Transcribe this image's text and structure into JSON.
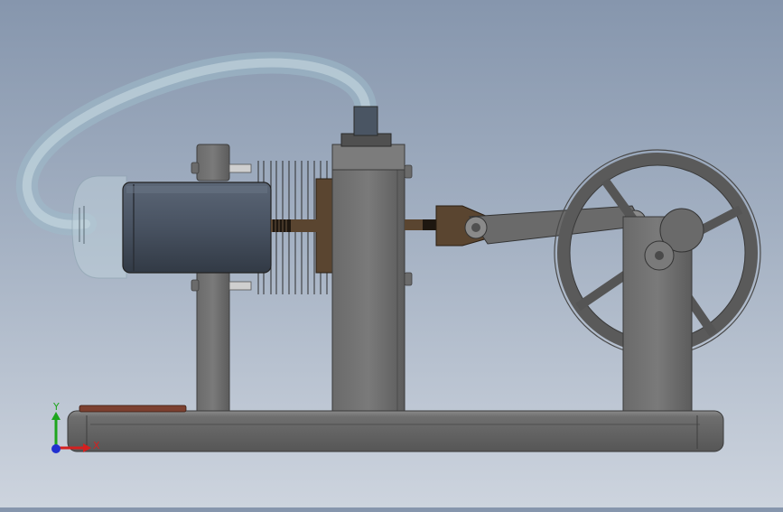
{
  "scene": {
    "kind": "cad-assembly-view",
    "subject": "stirling-engine-model",
    "background_top": "#8696ad",
    "background_bottom": "#cdd4de"
  },
  "colors": {
    "steel_dark": "#5e5e5e",
    "steel_mid": "#767676",
    "cylinder_body": "#4a5564",
    "brass_brown": "#5a4530",
    "hose_tint": "#b7d2de",
    "base_accent_red": "#8a3a2a"
  },
  "triad": {
    "x_label": "X",
    "y_label": "Y",
    "x_color": "#d42020",
    "y_color": "#1da51d",
    "z_color": "#2030d0"
  }
}
